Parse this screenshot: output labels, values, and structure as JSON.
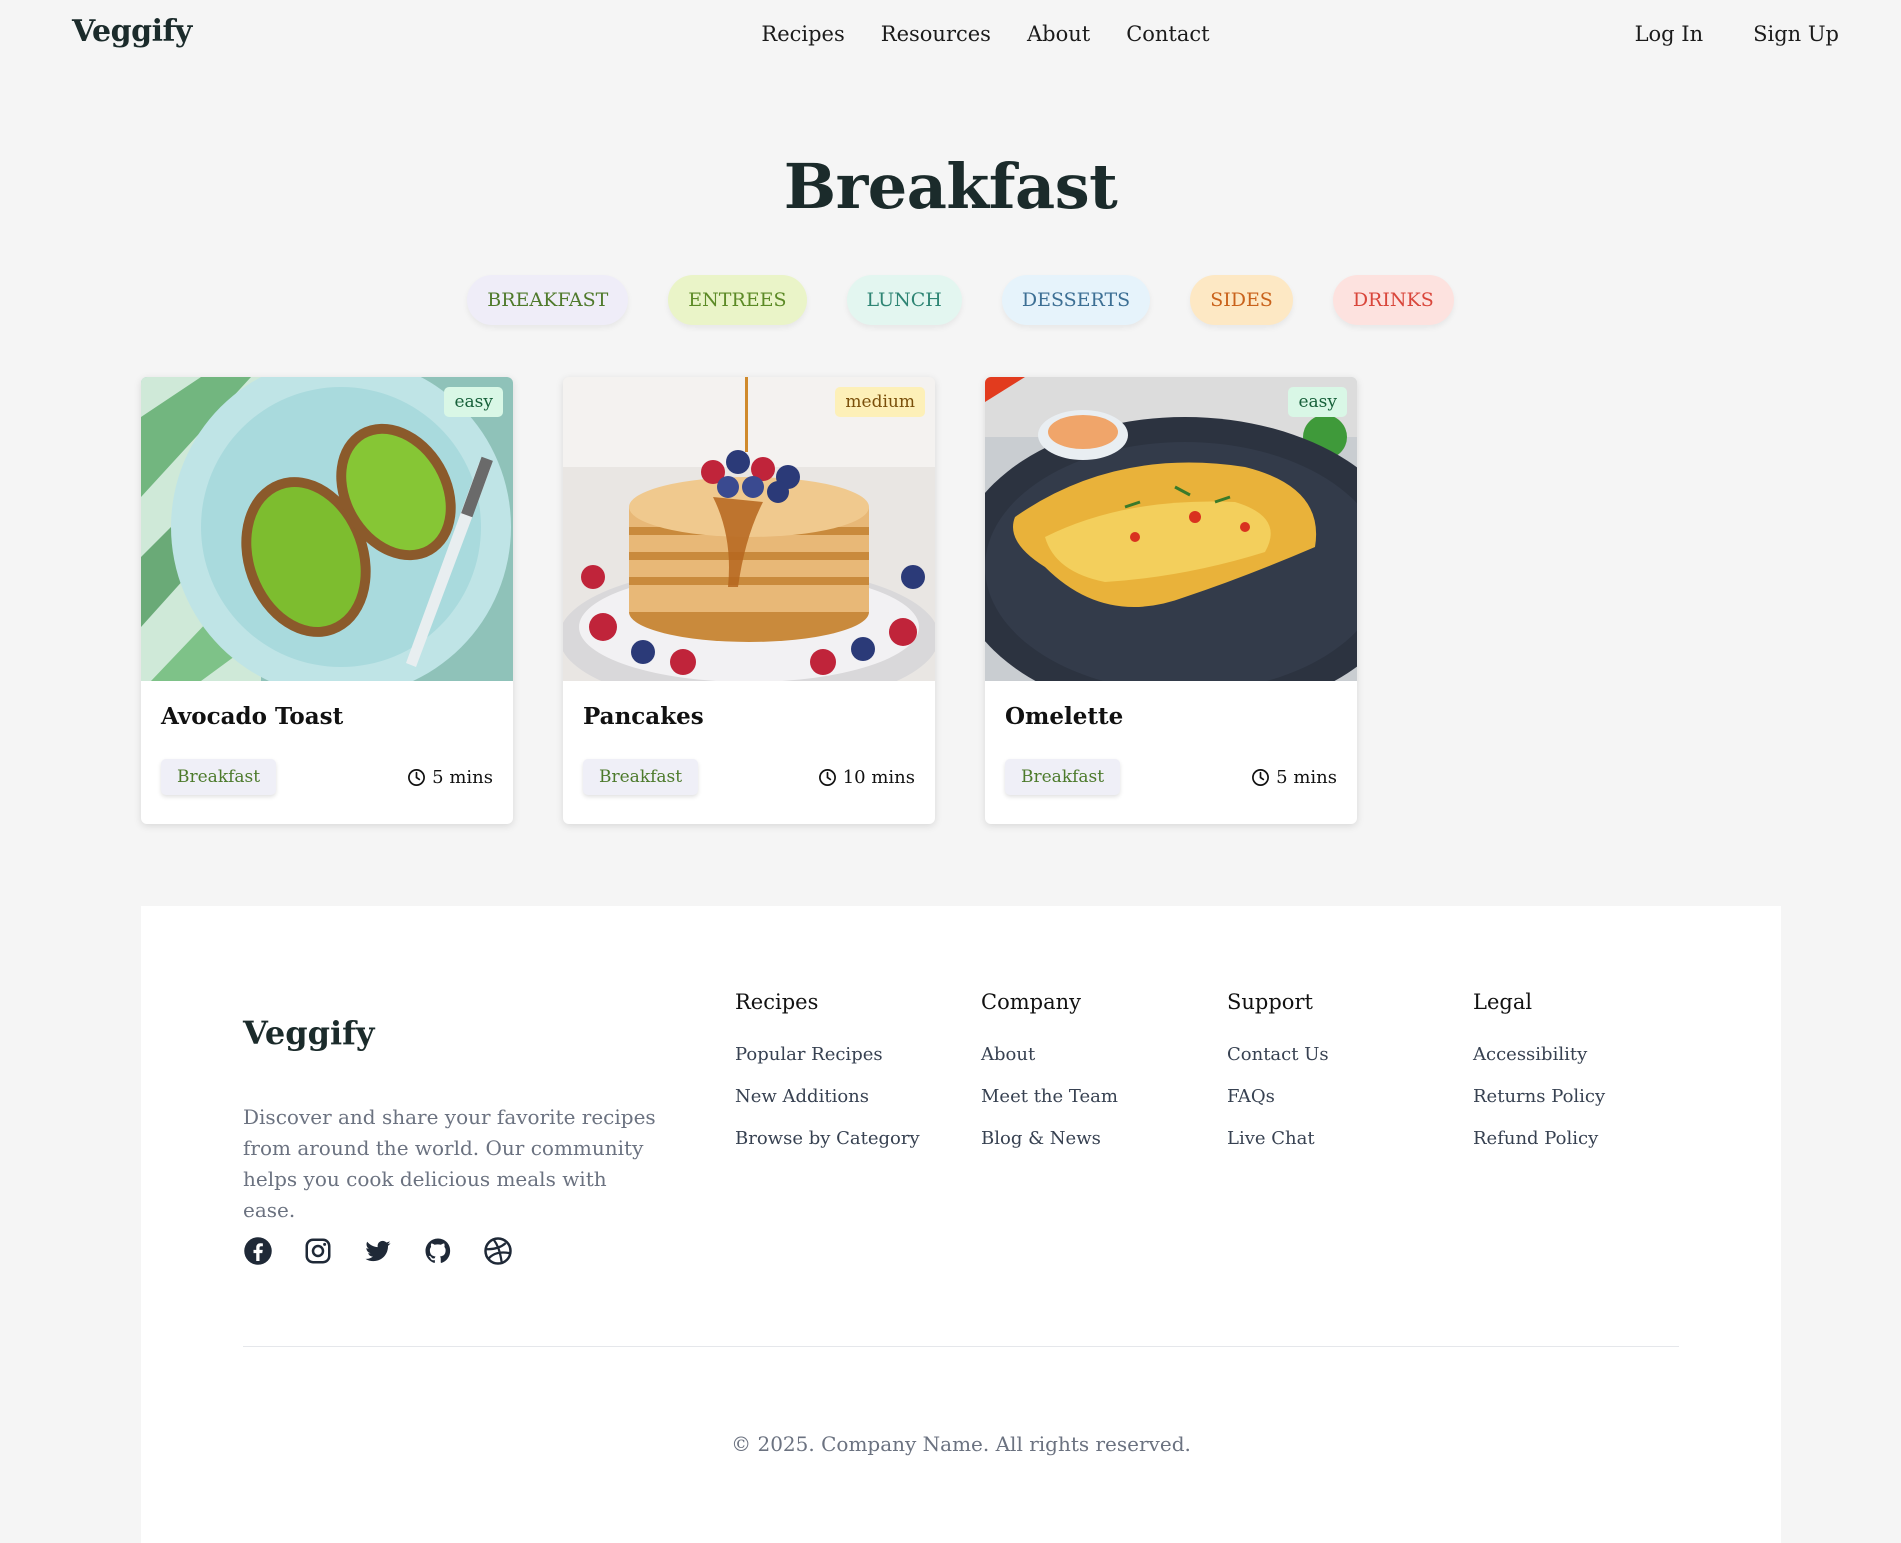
{
  "header": {
    "logo": "Veggify",
    "nav": [
      "Recipes",
      "Resources",
      "About",
      "Contact"
    ],
    "login": "Log In",
    "signup": "Sign Up"
  },
  "page": {
    "title": "Breakfast"
  },
  "categories": [
    {
      "label": "BREAKFAST",
      "bg": "#efedf8",
      "fg": "#4f7a2b"
    },
    {
      "label": "ENTREES",
      "bg": "#eaf4c8",
      "fg": "#5c8a26"
    },
    {
      "label": "LUNCH",
      "bg": "#e3f6f0",
      "fg": "#2f8574"
    },
    {
      "label": "DESSERTS",
      "bg": "#e6f3fb",
      "fg": "#3d6f94"
    },
    {
      "label": "SIDES",
      "bg": "#fde8c4",
      "fg": "#c9621b"
    },
    {
      "label": "DRINKS",
      "bg": "#fde2df",
      "fg": "#d9463b"
    }
  ],
  "recipes": [
    {
      "title": "Avocado Toast",
      "difficulty": "easy",
      "category": "Breakfast",
      "time": "5 mins",
      "image": "avocado-toast-photo"
    },
    {
      "title": "Pancakes",
      "difficulty": "medium",
      "category": "Breakfast",
      "time": "10 mins",
      "image": "pancakes-photo"
    },
    {
      "title": "Omelette",
      "difficulty": "easy",
      "category": "Breakfast",
      "time": "5 mins",
      "image": "omelette-photo"
    }
  ],
  "colors": {
    "easy_bg": "#d9f7e6",
    "easy_fg": "#17603a",
    "medium_bg": "#fdf0b8",
    "medium_fg": "#7a4f0a"
  },
  "footer": {
    "logo": "Veggify",
    "description": "Discover and share your favorite recipes from around the world. Our community helps you cook delicious meals with ease.",
    "socials": [
      "facebook-icon",
      "instagram-icon",
      "twitter-icon",
      "github-icon",
      "dribbble-icon"
    ],
    "columns": [
      {
        "heading": "Recipes",
        "links": [
          "Popular Recipes",
          "New Additions",
          "Browse by Category"
        ]
      },
      {
        "heading": "Company",
        "links": [
          "About",
          "Meet the Team",
          "Blog & News"
        ]
      },
      {
        "heading": "Support",
        "links": [
          "Contact Us",
          "FAQs",
          "Live Chat"
        ]
      },
      {
        "heading": "Legal",
        "links": [
          "Accessibility",
          "Returns Policy",
          "Refund Policy"
        ]
      }
    ],
    "copyright": "© 2025. Company Name. All rights reserved."
  }
}
